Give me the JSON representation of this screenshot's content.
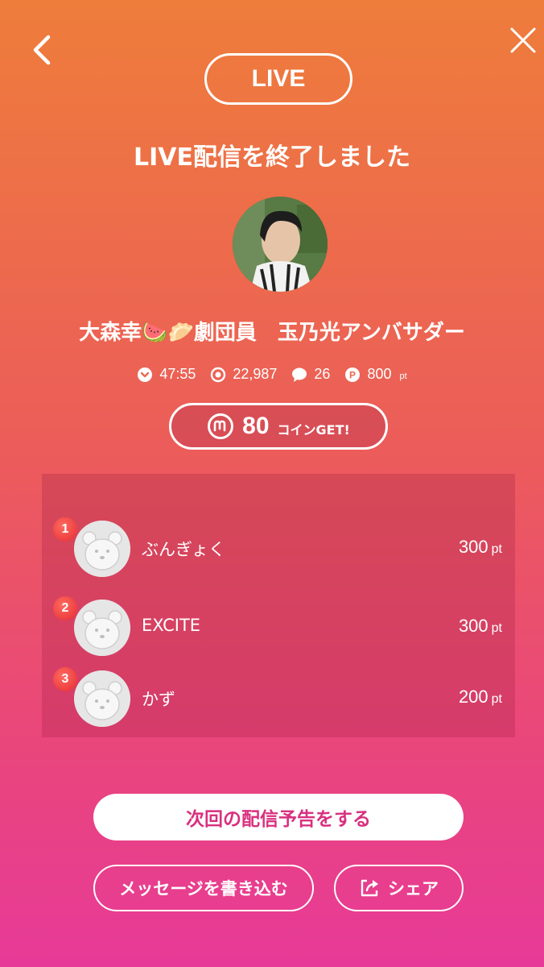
{
  "header": {
    "live_label": "LIVE",
    "title": "LIVE配信を終了しました"
  },
  "streamer": {
    "name_part1": "大森幸",
    "name_part2": "劇団員　玉乃光アンバサダー",
    "emoji1": "🍉",
    "emoji2": "🥟"
  },
  "stats": {
    "duration": "47:55",
    "viewers": "22,987",
    "comments": "26",
    "points": "800",
    "points_unit": "pt"
  },
  "coins": {
    "amount": "80",
    "label": "コインGET!"
  },
  "ranking": [
    {
      "rank": "1",
      "name": "ぶんぎょく",
      "points": "300",
      "unit": "pt"
    },
    {
      "rank": "2",
      "name": "EXCITE",
      "points": "300",
      "unit": "pt"
    },
    {
      "rank": "3",
      "name": "かず",
      "points": "200",
      "unit": "pt"
    }
  ],
  "buttons": {
    "next_stream": "次回の配信予告をする",
    "write_message": "メッセージを書き込む",
    "share": "シェア"
  },
  "colors": {
    "gradient_top": "#ee7d3b",
    "gradient_bottom": "#e73a98",
    "accent_pink": "#d8307f",
    "badge_red": "#e52b35"
  }
}
